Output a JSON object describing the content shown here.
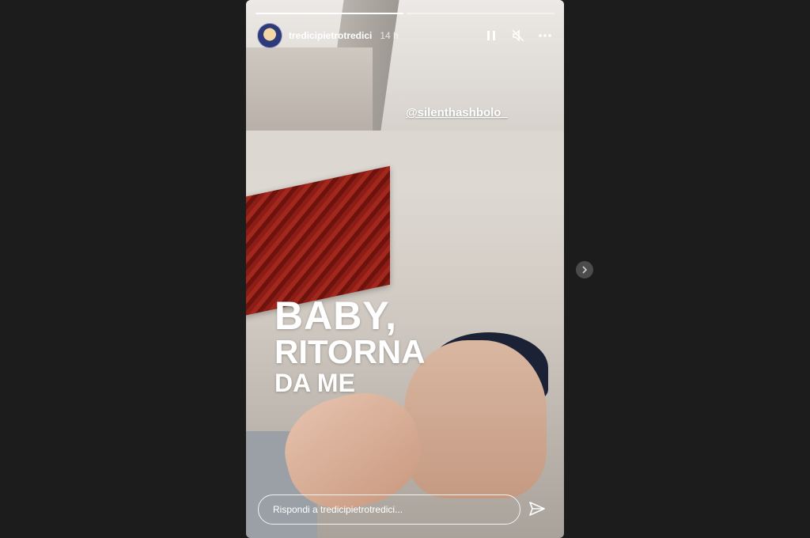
{
  "story": {
    "username": "tredicipietrotredici",
    "time": "14 h",
    "progress": [
      1.0,
      0.0
    ],
    "mention": "@silenthashbolo_",
    "text_lines": [
      "BABY,",
      "RITORNA",
      "DA ME"
    ],
    "reply_placeholder": "Rispondi a tredicipietrotredici..."
  },
  "icons": {
    "pause": "pause-icon",
    "mute": "mute-icon",
    "more": "more-icon",
    "send": "send-icon",
    "next": "chevron-right-icon"
  },
  "colors": {
    "backdrop": "#1c1c1c",
    "text": "#ffffff",
    "next_button": "#4b4b4b"
  }
}
